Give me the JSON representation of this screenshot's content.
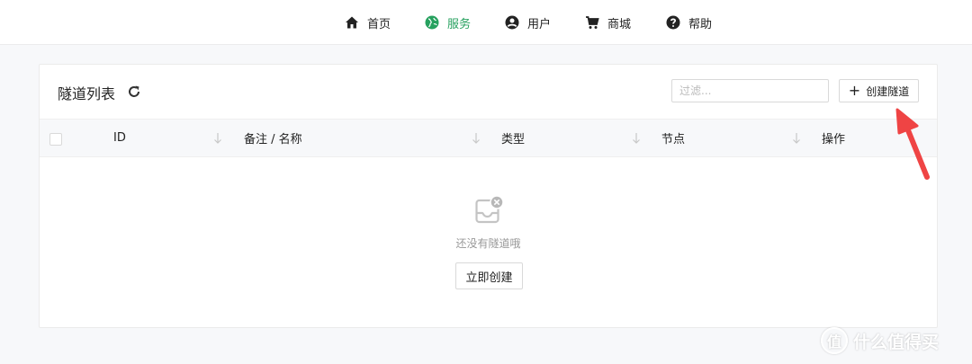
{
  "nav": {
    "items": [
      {
        "label": "首页",
        "icon": "home-icon"
      },
      {
        "label": "服务",
        "icon": "globe-icon",
        "active": true
      },
      {
        "label": "用户",
        "icon": "user-icon"
      },
      {
        "label": "商城",
        "icon": "cart-icon"
      },
      {
        "label": "帮助",
        "icon": "help-icon"
      }
    ],
    "active_color": "#27a15f"
  },
  "card": {
    "title": "隧道列表",
    "filter_placeholder": "过滤...",
    "create_button": "创建隧道"
  },
  "table": {
    "columns": [
      "ID",
      "备注 / 名称",
      "类型",
      "节点",
      "操作"
    ]
  },
  "empty": {
    "message": "还没有隧道哦",
    "button": "立即创建"
  },
  "annotation": {
    "arrow_color": "#ef4444"
  },
  "watermark": {
    "logo": "值",
    "text": "什么值得买"
  }
}
